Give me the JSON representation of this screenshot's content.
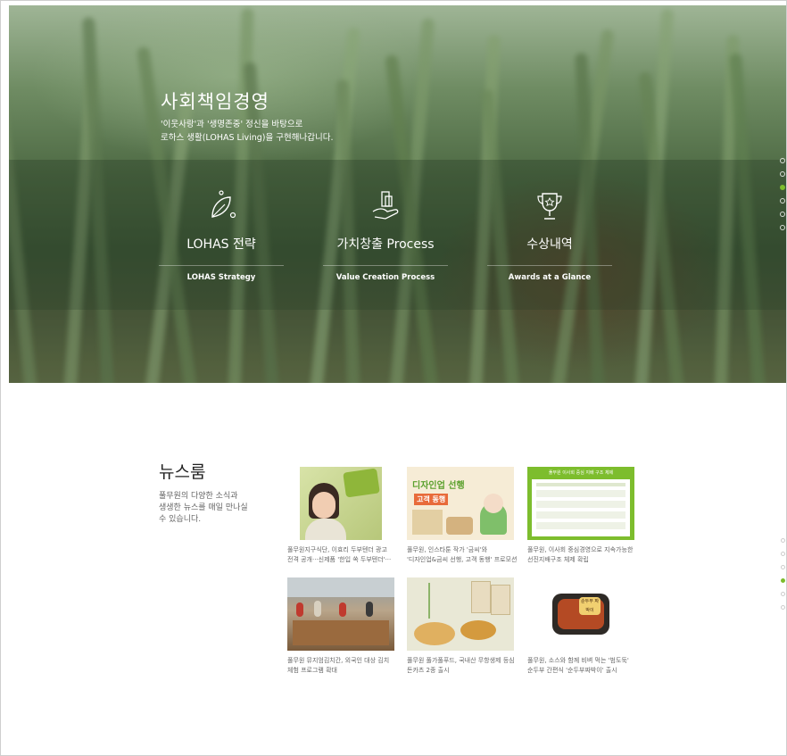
{
  "hero": {
    "title": "사회책임경영",
    "desc_line1": "'이웃사랑'과 '생명존중' 정신을 바탕으로",
    "desc_line2": "로하스 생활(LOHAS Living)을 구현해나갑니다.",
    "cards": [
      {
        "title": "LOHAS 전략",
        "subtitle": "LOHAS Strategy",
        "icon": "leaf-icon"
      },
      {
        "title": "가치창출 Process",
        "subtitle": "Value Creation Process",
        "icon": "hand-value-icon"
      },
      {
        "title": "수상내역",
        "subtitle": "Awards at a Glance",
        "icon": "trophy-icon"
      }
    ],
    "active_dot": 3,
    "dot_count": 6
  },
  "news": {
    "title": "뉴스룸",
    "desc_line1": "풀무원의 다양한 소식과",
    "desc_line2": "생생한 뉴스를 매일 만나실",
    "desc_line3": "수 있습니다.",
    "items": [
      {
        "line1": "풀무원지구식단, 이효리 두부텐더 광고",
        "line2": "전격 공개···신제품 '한입 쏙 두부텐더'···"
      },
      {
        "line1": "풀무원, 인스타툰 작가 '금씨'와",
        "line2": "'디자인업&금씨 선행, 고객 동행' 프로모션"
      },
      {
        "line1": "풀무원, 이사회 중심경영으로 지속가능한",
        "line2": "선진지배구조 체제 확립"
      },
      {
        "line1": "풀무원 뮤지엄김치간, 외국인 대상 김치",
        "line2": "체험 프로그램 확대"
      },
      {
        "line1": "풀무원 풀가풀푸드, 국내산 무항생제 등심",
        "line2": "돈카츠 2종 출시"
      },
      {
        "line1": "풀무원, 소스와 함께 비벼 먹는 '범도둑'",
        "line2": "순두부 간편식 '순두부짜박이' 출시"
      }
    ],
    "thumb2_text1": "디자인업 선행",
    "thumb2_text2": "고객 동행",
    "thumb3_heading": "풀무원 이사회 중심 지배 구조 체제",
    "thumb6_label": "순두부 짜박이",
    "active_dot": 4,
    "dot_count": 6
  },
  "colors": {
    "accent": "#7dbd2d",
    "hero_green": "#4e6a44"
  }
}
